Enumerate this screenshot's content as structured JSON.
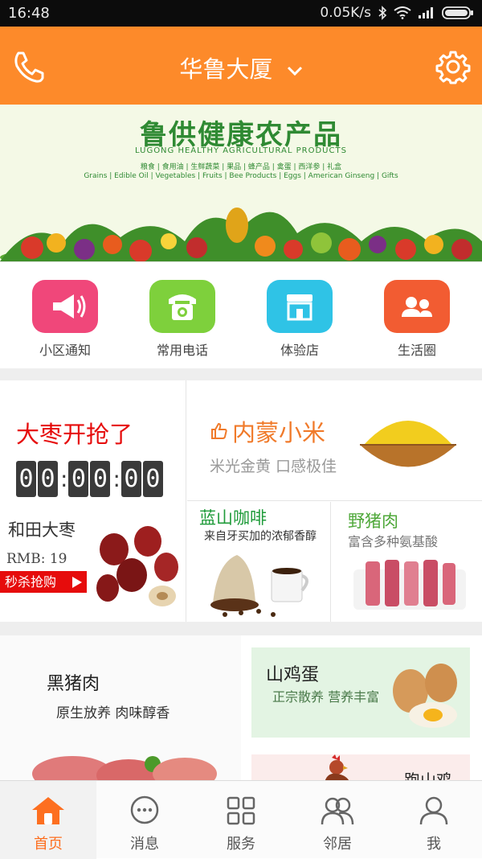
{
  "status_bar": {
    "time": "16:48",
    "network_speed": "0.05K/s"
  },
  "header": {
    "title": "华鲁大厦"
  },
  "banner": {
    "title": "鲁供健康农产品",
    "subtitle": "LUGONG HEALTHY AGRICULTURAL PRODUCTS",
    "categories_cn": "粮食 | 食用油 | 生鲜蔬菜 | 果品 | 蜂产品 | 禽蛋 | 西洋参 | 礼盒",
    "categories_en": "Grains | Edible Oil | Vegetables | Fruits | Bee Products | Eggs | American Ginseng | Gifts"
  },
  "quick_actions": [
    {
      "label": "小区通知",
      "icon": "megaphone-icon",
      "color": "#f0477a"
    },
    {
      "label": "常用电话",
      "icon": "telephone-icon",
      "color": "#7ed03c"
    },
    {
      "label": "体验店",
      "icon": "store-icon",
      "color": "#2fc3e6"
    },
    {
      "label": "生活圈",
      "icon": "people-icon",
      "color": "#f25c32"
    }
  ],
  "flash_sale": {
    "title": "大枣开抢了",
    "countdown": [
      "0",
      "0",
      "0",
      "0",
      "0",
      "0"
    ],
    "product": "和田大枣",
    "price": "RMB: 19",
    "button": "秒杀抢购"
  },
  "promo_millet": {
    "title": "内蒙小米",
    "subtitle": "米光金黄 口感极佳"
  },
  "promo_coffee": {
    "title": "蓝山咖啡",
    "subtitle": "来自牙买加的浓郁香醇"
  },
  "promo_boar": {
    "title": "野猪肉",
    "subtitle": "富含多种氨基酸"
  },
  "feature_pork": {
    "title": "黑猪肉",
    "subtitle": "原生放养 肉味醇香"
  },
  "feature_egg": {
    "title": "山鸡蛋",
    "subtitle": "正宗散养 营养丰富"
  },
  "feature_chicken": {
    "title": "跑山鸡"
  },
  "tabbar": [
    {
      "label": "首页",
      "icon": "home-icon",
      "active": true
    },
    {
      "label": "消息",
      "icon": "message-icon",
      "active": false
    },
    {
      "label": "服务",
      "icon": "grid-icon",
      "active": false
    },
    {
      "label": "邻居",
      "icon": "neighbors-icon",
      "active": false
    },
    {
      "label": "我",
      "icon": "profile-icon",
      "active": false
    }
  ],
  "colors": {
    "accent": "#fd8a2a",
    "flash_red": "#e60c0c",
    "tab_active": "#fd6f20"
  }
}
